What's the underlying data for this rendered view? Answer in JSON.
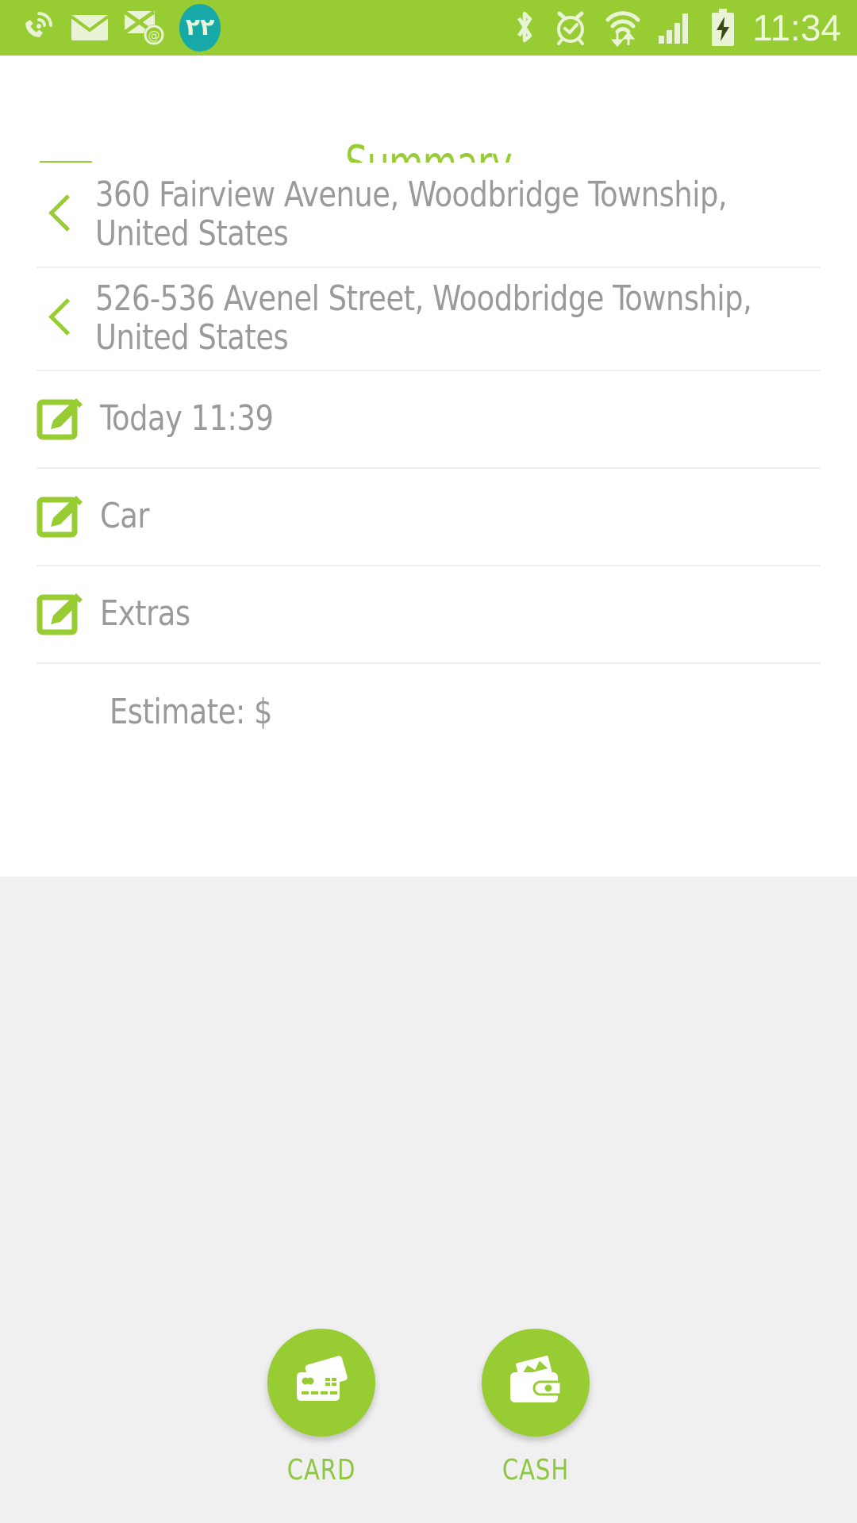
{
  "status_bar": {
    "icons_left": [
      "wifi-calling-icon",
      "sms-envelope-icon",
      "email-at-icon"
    ],
    "notification_badge": "٢٢",
    "icons_right": [
      "bluetooth-icon",
      "alarm-clock-icon",
      "wifi-data-icon",
      "signal-bars-icon",
      "battery-charging-icon"
    ],
    "time": "11:34",
    "background_color": "#97cc33"
  },
  "header": {
    "menu_icon": "hamburger-menu-icon",
    "title": "Summary",
    "title_color": "#97cc33"
  },
  "summary": {
    "pickup": {
      "icon": "chevron-left-icon",
      "address": "360 Fairview Avenue, Woodbridge Township, United States"
    },
    "dropoff": {
      "icon": "chevron-left-icon",
      "address": "526-536 Avenel Street, Woodbridge Township, United States"
    },
    "items": [
      {
        "icon": "edit-pencil-icon",
        "label": "Today 11:39"
      },
      {
        "icon": "edit-pencil-icon",
        "label": "Car"
      },
      {
        "icon": "edit-pencil-icon",
        "label": "Extras"
      }
    ],
    "estimate_label": "Estimate: $",
    "text_color": "#9a9a9a"
  },
  "payment": {
    "options": [
      {
        "icon": "credit-cards-icon",
        "label": "CARD"
      },
      {
        "icon": "wallet-cash-icon",
        "label": "CASH"
      }
    ],
    "accent_color": "#97cc33",
    "background_color": "#f0f0f0"
  }
}
